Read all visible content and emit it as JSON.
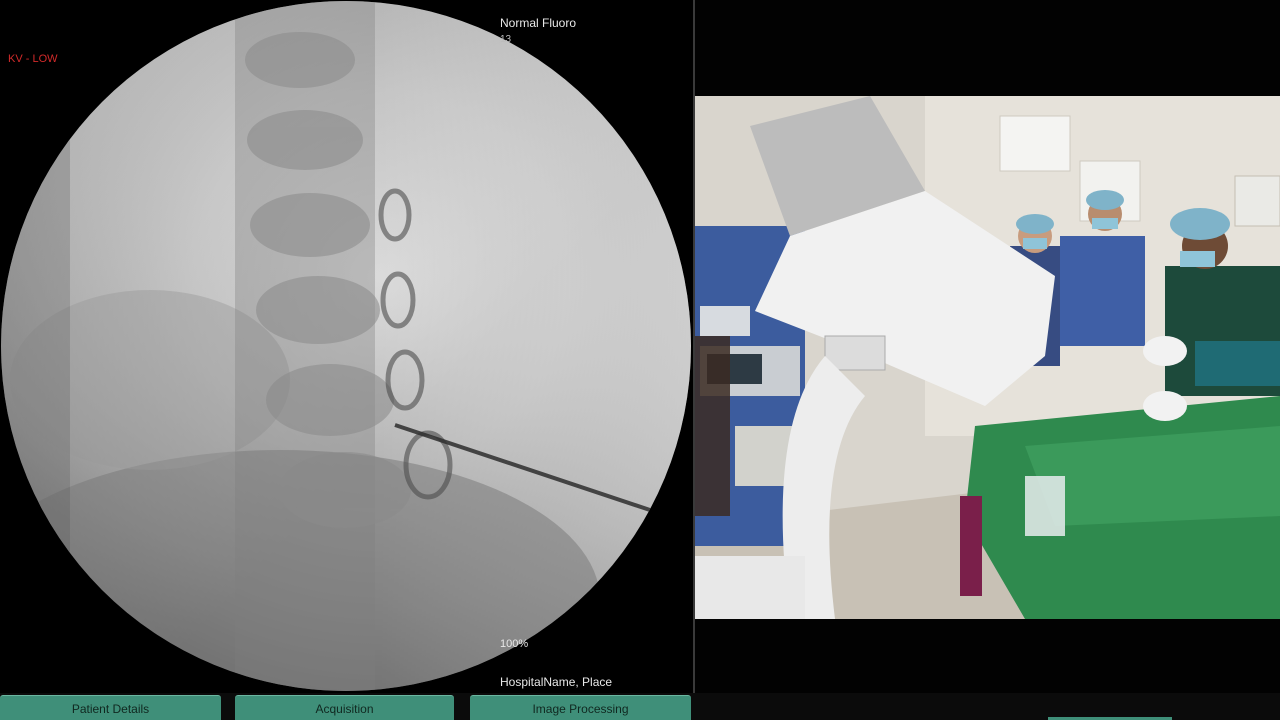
{
  "fluoro": {
    "kv_label": "KV - LOW",
    "mode_label": "Normal Fluoro",
    "mode_sub": "13",
    "zoom_label": "100%",
    "hospital_label": "HospitalName, Place"
  },
  "tabs": [
    {
      "label": "Patient Details"
    },
    {
      "label": "Acquisition"
    },
    {
      "label": "Image Processing"
    }
  ],
  "colors": {
    "accent": "#3f8f79",
    "warning": "#d22a2a"
  }
}
